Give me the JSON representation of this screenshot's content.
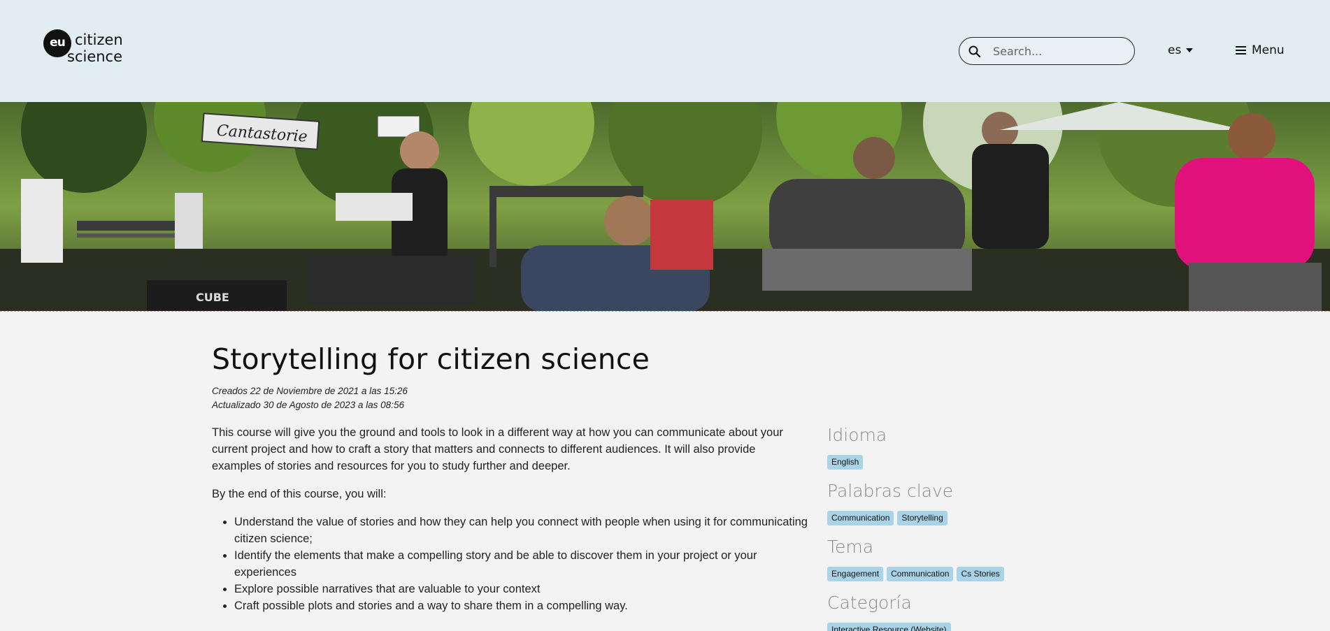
{
  "header": {
    "logo": {
      "mark": "eu",
      "line1": "citizen",
      "line2": "science"
    },
    "search": {
      "placeholder": "Search...",
      "icon": "search-icon"
    },
    "language": {
      "label": "es"
    },
    "menu": {
      "label": "Menu",
      "icon": "hamburger-icon"
    }
  },
  "hero": {
    "sign_text": "Cantastorie",
    "amp_label": "CUBE"
  },
  "article": {
    "title": "Storytelling for citizen science",
    "created": "Creados 22 de Noviembre de 2021 a las 15:26",
    "updated": "Actualizado 30 de Agosto de 2023 a las 08:56",
    "paragraph1": "This course will give you the ground and tools to look in a different way at how you can communicate about your current project and how to craft a story that matters and connects to different audiences. It will also provide examples of stories and resources for you to study further and deeper.",
    "paragraph2": "By the end of this course, you will:",
    "bullets": [
      "Understand the value of stories and how they can help you connect with people when using it for communicating citizen science;",
      "Identify the elements that make a compelling story and be able to discover them in your project or your experiences",
      "Explore possible narratives that are valuable to your context",
      "Craft possible plots and stories and a way to share them in a compelling way."
    ]
  },
  "sidebar": {
    "idioma": {
      "heading": "Idioma",
      "tags": [
        "English"
      ]
    },
    "palabras": {
      "heading": "Palabras clave",
      "tags": [
        "Communication",
        "Storytelling"
      ]
    },
    "tema": {
      "heading": "Tema",
      "tags": [
        "Engagement",
        "Communication",
        "Cs Stories"
      ]
    },
    "categoria": {
      "heading": "Categoría",
      "tags": [
        "Interactive Resource (Website)"
      ]
    }
  },
  "colors": {
    "header_bg": "#e2ecf3",
    "page_bg": "#f4f3f3",
    "tag_bg": "#a9d3e6",
    "heading_gray": "#8a8a8a"
  }
}
